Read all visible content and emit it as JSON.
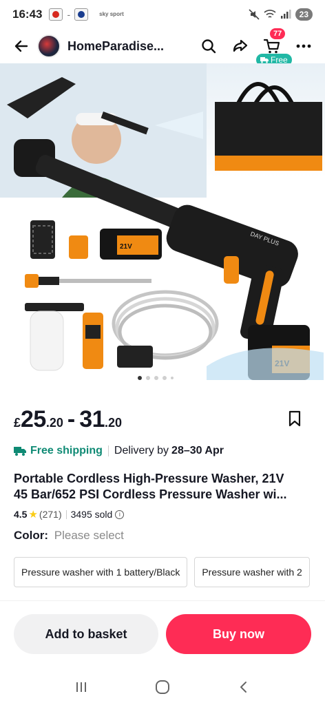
{
  "status_bar": {
    "time": "16:43",
    "separator": "-",
    "sky_logo": "sky sport",
    "battery": "23",
    "colors": {
      "badge_red": "#d6281e",
      "badge_blue": "#1a3d8f"
    }
  },
  "nav": {
    "shop_name": "HomeParadise...",
    "cart_count": "77",
    "free_label": "Free",
    "icons": [
      "back-arrow-icon",
      "search-icon",
      "share-icon",
      "cart-icon",
      "more-icon"
    ]
  },
  "gallery": {
    "image_label": "DAY PLUS",
    "battery_label": "21V",
    "total_dots": 5,
    "active_dot": 1
  },
  "price": {
    "currency": "£",
    "low_whole": "25",
    "low_cents": ".20",
    "dash": "-",
    "high_whole": "31",
    "high_cents": ".20"
  },
  "shipping": {
    "free_label": "Free shipping",
    "delivery_prefix": "Delivery by",
    "delivery_dates": "28–30 Apr"
  },
  "product": {
    "title_line1": "Portable Cordless High-Pressure Washer, 21V",
    "title_line2": "45 Bar/652 PSI Cordless Pressure Washer wi...",
    "rating": "4.5",
    "review_count": "(271)",
    "sold": "3495 sold"
  },
  "color": {
    "label": "Color:",
    "value": "Please select",
    "options": [
      "Pressure washer with 1 battery/Black",
      "Pressure washer with 2"
    ]
  },
  "actions": {
    "add_to_basket": "Add to basket",
    "buy_now": "Buy now",
    "accent": "#fe2c55"
  }
}
